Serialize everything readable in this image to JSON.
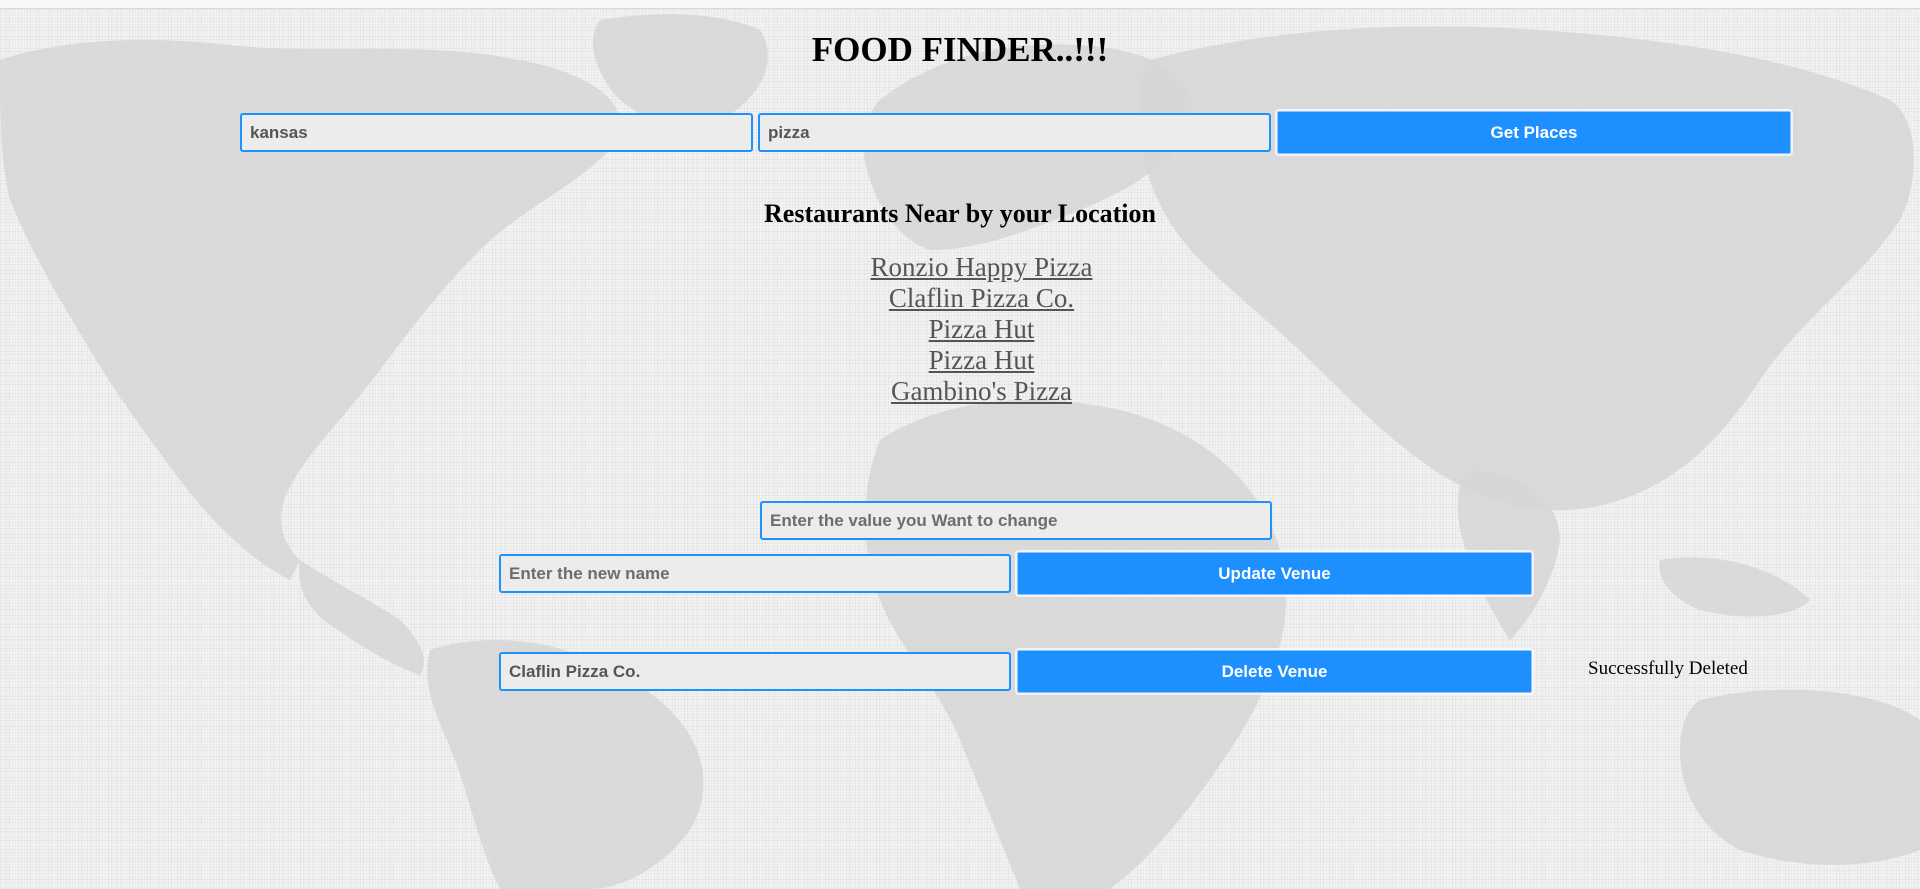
{
  "header": {
    "title": "FOOD FINDER..!!!"
  },
  "search": {
    "location_value": "kansas",
    "query_value": "pizza",
    "get_places_label": "Get Places"
  },
  "results": {
    "heading": "Restaurants Near by your Location",
    "venues": [
      "Ronzio Happy Pizza",
      "Claflin Pizza Co.",
      "Pizza Hut",
      "Pizza Hut",
      "Gambino's Pizza"
    ]
  },
  "update": {
    "old_value_placeholder": "Enter the value you Want to change",
    "new_name_placeholder": "Enter the new name",
    "button_label": "Update Venue"
  },
  "delete": {
    "value": "Claflin Pizza Co.",
    "button_label": "Delete Venue",
    "status": "Successfully Deleted"
  },
  "colors": {
    "accent": "#1e8fff",
    "link": "#555555",
    "map": "#d6d6d6"
  },
  "icons": [
    "world-map"
  ]
}
